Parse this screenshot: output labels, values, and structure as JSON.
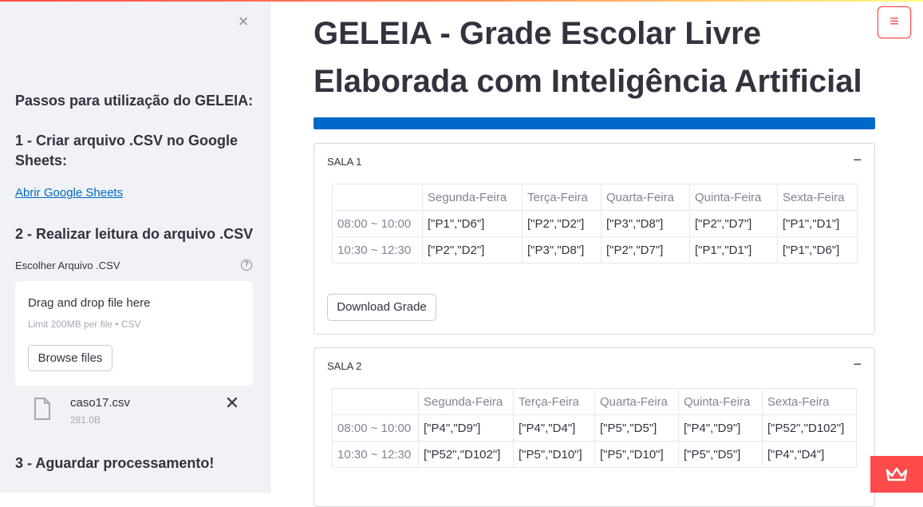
{
  "sidebar": {
    "close_symbol": "×",
    "steps_title": "Passos para utilização do GELEIA:",
    "step1": "1 - Criar arquivo .CSV no Google Sheets:",
    "step1_link": "Abrir Google Sheets",
    "step2": "2 - Realizar leitura do arquivo .CSV",
    "uploader_label": "Escolher Arquivo .CSV",
    "help_symbol": "?",
    "dropzone_title": "Drag and drop file here",
    "dropzone_limit": "Limit 200MB per file • CSV",
    "browse_label": "Browse files",
    "file_name": "caso17.csv",
    "file_size": "281.0B",
    "remove_symbol": "✕",
    "step3": "3 - Aguardar processamento!"
  },
  "main": {
    "menu_symbol": "≡",
    "title": "GELEIA - Grade Escolar Livre Elaborada com Inteligência Artificial",
    "progress_fraction": 1.0,
    "days": [
      "Segunda-Feira",
      "Terça-Feira",
      "Quarta-Feira",
      "Quinta-Feira",
      "Sexta-Feira"
    ],
    "rooms": [
      {
        "name": "SALA 1",
        "toggle": "−",
        "rows": [
          {
            "time": "08:00 ~ 10:00",
            "cells": [
              "[\"P1\",\"D6\"]",
              "[\"P2\",\"D2\"]",
              "[\"P3\",\"D8\"]",
              "[\"P2\",\"D7\"]",
              "[\"P1\",\"D1\"]"
            ]
          },
          {
            "time": "10:30 ~ 12:30",
            "cells": [
              "[\"P2\",\"D2\"]",
              "[\"P3\",\"D8\"]",
              "[\"P2\",\"D7\"]",
              "[\"P1\",\"D1\"]",
              "[\"P1\",\"D6\"]"
            ]
          }
        ],
        "download_label": "Download Grade"
      },
      {
        "name": "SALA 2",
        "toggle": "−",
        "rows": [
          {
            "time": "08:00 ~ 10:00",
            "cells": [
              "[\"P4\",\"D9\"]",
              "[\"P4\",\"D4\"]",
              "[\"P5\",\"D5\"]",
              "[\"P4\",\"D9\"]",
              "[\"P52\",\"D102\"]"
            ]
          },
          {
            "time": "10:30 ~ 12:30",
            "cells": [
              "[\"P52\",\"D102\"]",
              "[\"P5\",\"D10\"]",
              "[\"P5\",\"D10\"]",
              "[\"P5\",\"D5\"]",
              "[\"P4\",\"D4\"]"
            ]
          }
        ]
      }
    ]
  },
  "colors": {
    "accent": "#ff4b4b",
    "progress": "#0068c9",
    "link": "#0068c9"
  },
  "icons": [
    "close-icon",
    "help-icon",
    "file-icon",
    "remove-file-icon",
    "menu-icon",
    "collapse-icon",
    "streamlit-crown-icon"
  ]
}
